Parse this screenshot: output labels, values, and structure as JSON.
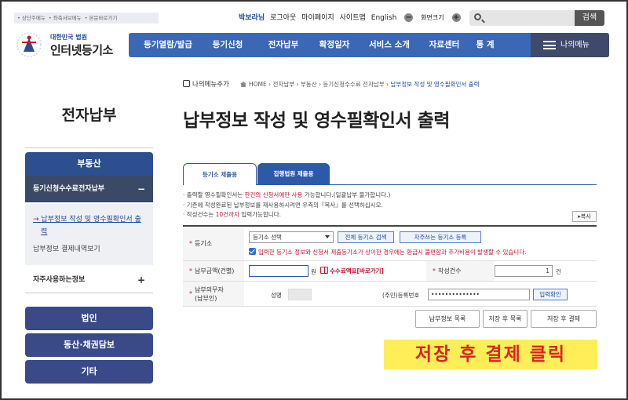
{
  "utility": {
    "items": [
      "• 상단주메뉴",
      "• 좌측서브메뉴",
      "• 본문바로가기"
    ]
  },
  "top_links": {
    "user": "박보라님",
    "logout": "로그아웃",
    "mypage": "마이페이지",
    "sitemap": "사이트맵",
    "english": "English",
    "zoom_minus": "−",
    "zoom_label": "화면크기",
    "zoom_plus": "+"
  },
  "search": {
    "placeholder": "",
    "button": "검색"
  },
  "logo": {
    "small": "대한민국 법원",
    "big": "인터넷등기소"
  },
  "nav": {
    "items": [
      "등기열람/발급",
      "등기신청",
      "전자납부",
      "확정일자",
      "서비스 소개",
      "자료센터",
      "통 계"
    ],
    "menu": "나의메뉴"
  },
  "sidebar": {
    "title": "전자납부",
    "head": "부동산",
    "sub": "등기신청수수료전자납부",
    "sub_icon": "−",
    "link1_line1": "→ 납부정보 작성 및 영수필확인서 출",
    "link1_line2": "력",
    "link2": "납부정보 결제내역보기",
    "item2": "자주사용하는정보",
    "item2_icon": "+",
    "buttons": [
      "법인",
      "동산·채권담보",
      "기타"
    ]
  },
  "breadcrumb": {
    "fav": "나의메뉴추가",
    "home": "HOME",
    "path": "› 전자납부 › 부동산 › 등기신청수수료 전자납부 ›",
    "current": "납부정보 작성 및 영수필확인서 출력"
  },
  "page_title": "납부정보 작성 및 영수필확인서 출력",
  "tabs": [
    "등기소 제출용",
    "집행법원 제출용"
  ],
  "notes": {
    "line1_a": "· 출력할 영수필확인서는 ",
    "line1_red": "한건의 신청서에만 사용",
    "line1_b": " 가능합니다.(일괄납부 불가합니다.)",
    "line2": "· 기존에 작성완료된 납부정보를 재사용하시려면 우측의『복사』를 선택하십시오.",
    "line3_a": "· 작성건수는 ",
    "line3_red": "10건까지",
    "line3_b": " 입력가능합니다."
  },
  "copy_button": "▸복사",
  "form": {
    "required_mark": "*",
    "registry_label": "등기소",
    "registry_select": "등기소 선택",
    "all_registry_btn": "전체 등기소 검색",
    "frequent_btn": "자주쓰는 등기소 등록",
    "warning": "입력한 등기소 정보와 신청서 제출등기소가 상이한 경우에는 환급시 불편함과 추가비용이 발생할 수 있습니다.",
    "amount_label": "납부금액(건별)",
    "amount_value": "",
    "won": "원",
    "fee_table_link": "수수료액표[바로가기]",
    "count_label": "작성건수",
    "count_value": "1",
    "count_unit": "건",
    "payer_label_1": "납부의무자",
    "payer_label_2": "(납부인)",
    "name_label": "성명",
    "name_value": "",
    "id_label": "(주민)등록번호",
    "id_value": "••••••••••••••",
    "verify_btn": "입력확인"
  },
  "buttons": {
    "list": "납부정보 목록",
    "save_list": "저장 후 목록",
    "save_pay": "저장 후 결제"
  },
  "annotation": "저장 후 결제 클릭"
}
